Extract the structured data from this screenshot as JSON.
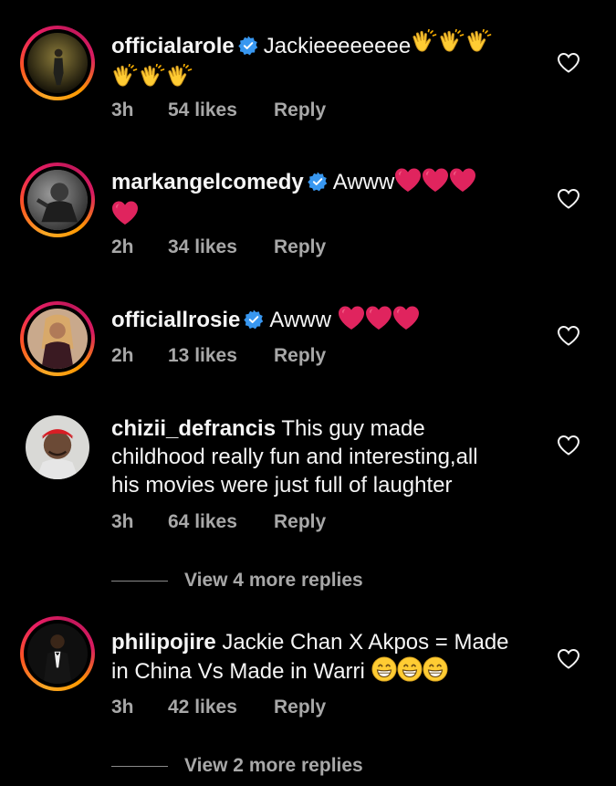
{
  "comments": [
    {
      "username": "officialarole",
      "verified": true,
      "text": "Jackieeeeeeee",
      "emojis_line1": "clap-clap-clap",
      "emojis_line2": "clap-clap-clap",
      "time": "3h",
      "likes": "54 likes",
      "reply": "Reply"
    },
    {
      "username": "markangelcomedy",
      "verified": true,
      "text": "Awww",
      "emojis_line1": "heart-heart-heart",
      "emojis_line2": "heart",
      "time": "2h",
      "likes": "34 likes",
      "reply": "Reply"
    },
    {
      "username": "officiallrosie",
      "verified": true,
      "text": "Awww",
      "emojis_line1": "heart-heart-heart",
      "time": "2h",
      "likes": "13 likes",
      "reply": "Reply"
    },
    {
      "username": "chizii_defrancis",
      "verified": false,
      "text_line1": "This guy made",
      "text_line2": "childhood really fun and interesting,all",
      "text_line3": "his movies were just full of laughter",
      "time": "3h",
      "likes": "64 likes",
      "reply": "Reply",
      "view_more": "View 4 more replies"
    },
    {
      "username": "philipojire",
      "verified": false,
      "text_line1": "Jackie Chan X Akpos = Made",
      "text_line2": "in China Vs Made in Warri",
      "emojis_line2": "grin-grin-grin",
      "time": "3h",
      "likes": "42 likes",
      "reply": "Reply",
      "view_more": "View 2 more replies"
    }
  ],
  "colors": {
    "background": "#000000",
    "text": "#f5f5f5",
    "muted": "#a8a8a8",
    "verified": "#3897f0",
    "heart_emoji": "#e0245e",
    "clap_emoji": "#ffcc33"
  },
  "icons": {
    "like": "heart-outline-icon",
    "verified": "verified-badge-icon"
  }
}
